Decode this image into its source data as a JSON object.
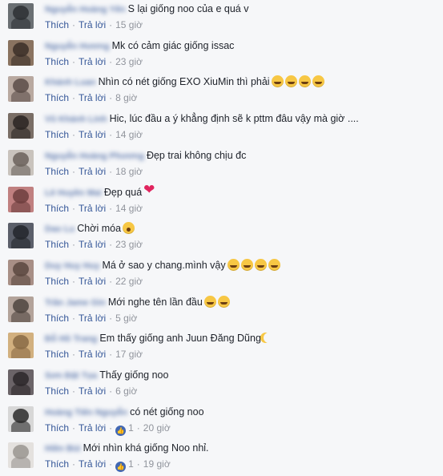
{
  "actions": {
    "like": "Thích",
    "reply": "Trả lời"
  },
  "colors": {
    "link": "#365899",
    "muted": "#90949c",
    "like_badge": "#4267b2"
  },
  "comments": [
    {
      "author": "Nguyễn Hoàng Yến",
      "text": "S lại giống noo của e quá v",
      "emojis": [],
      "time": "15 giờ"
    },
    {
      "author": "Nguyễn Hương",
      "text": "Mk có cảm giác giống issac",
      "emojis": [],
      "time": "23 giờ"
    },
    {
      "author": "Khánh Luan",
      "text": "Nhìn có nét giống EXO XiuMin thì phải",
      "emojis": [
        "rofl-emoji",
        "grin-emoji",
        "grin-emoji",
        "rofl-emoji"
      ],
      "time": "8 giờ"
    },
    {
      "author": "Vũ Khánh Linh",
      "text": "Hic, lúc đầu a ý khẳng định sẽ k pttm đâu vậy mà giờ ....",
      "emojis": [],
      "time": "14 giờ"
    },
    {
      "author": "Nguyễn Hoàng Phương",
      "text": "Đẹp trai không chịu đc",
      "emojis": [],
      "time": "18 giờ"
    },
    {
      "author": "Lê Huyền Mai",
      "text": "Đẹp quá",
      "emojis": [
        "heart-emoji"
      ],
      "time": "14 giờ"
    },
    {
      "author": "Dao Lu",
      "text": "Chời móa",
      "emojis": [
        "wow-emoji"
      ],
      "time": "23 giờ"
    },
    {
      "author": "Duy Huy Huy",
      "text": "Má ở sao y chang.mình vậy",
      "emojis": [
        "grin-emoji",
        "grin-emoji",
        "grin-emoji",
        "grin-emoji"
      ],
      "time": "22 giờ"
    },
    {
      "author": "Trần Jame Gin",
      "text": "Mới nghe tên lần đầu",
      "emojis": [
        "smirk-emoji",
        "smirk-emoji"
      ],
      "time": "5 giờ"
    },
    {
      "author": "Đỗ Hồ Trang",
      "text": "Em thấy giống anh Juun Đăng Dũng",
      "emojis": [
        "moon-emoji"
      ],
      "time": "17 giờ"
    },
    {
      "author": "Sơn Đặt Tọa",
      "text": "Thấy giống noo",
      "emojis": [],
      "time": "6 giờ"
    },
    {
      "author": "Hoàng Tiến Nguyễn",
      "text": "có nét giống noo",
      "emojis": [],
      "time": "20 giờ",
      "likes": "1"
    },
    {
      "author": "Hiền Bùi",
      "text": "Mới nhìn khá giống Noo nhỉ.",
      "emojis": [],
      "time": "19 giờ",
      "likes": "1"
    }
  ]
}
